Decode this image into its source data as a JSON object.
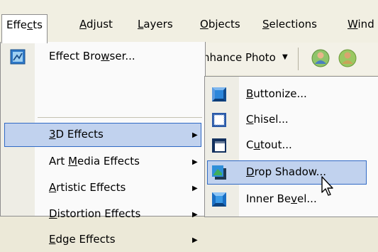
{
  "menubar": {
    "items": [
      {
        "pre": "Effe",
        "acc": "c",
        "post": "ts"
      },
      {
        "pre": "",
        "acc": "A",
        "post": "djust"
      },
      {
        "pre": "",
        "acc": "L",
        "post": "ayers"
      },
      {
        "pre": "",
        "acc": "O",
        "post": "bjects"
      },
      {
        "pre": "",
        "acc": "S",
        "post": "elections"
      },
      {
        "pre": "",
        "acc": "W",
        "post": "ind"
      }
    ]
  },
  "toolbar": {
    "enhance_label": "nhance Photo",
    "dropdown_arrow": "▼"
  },
  "effects_menu": {
    "items": [
      {
        "pre": "Effect Bro",
        "acc": "w",
        "post": "ser...",
        "arrow": ""
      },
      {
        "pre": "",
        "acc": "3",
        "post": "D Effects",
        "arrow": "▶"
      },
      {
        "pre": "Art ",
        "acc": "M",
        "post": "edia Effects",
        "arrow": "▶"
      },
      {
        "pre": "",
        "acc": "A",
        "post": "rtistic Effects",
        "arrow": "▶"
      },
      {
        "pre": "",
        "acc": "D",
        "post": "istortion Effects",
        "arrow": "▶"
      },
      {
        "pre": "",
        "acc": "E",
        "post": "dge Effects",
        "arrow": "▶"
      }
    ]
  },
  "submenu": {
    "items": [
      {
        "pre": "",
        "acc": "B",
        "post": "uttonize..."
      },
      {
        "pre": "",
        "acc": "C",
        "post": "hisel..."
      },
      {
        "pre": "C",
        "acc": "u",
        "post": "tout..."
      },
      {
        "pre": "",
        "acc": "D",
        "post": "rop Shadow..."
      },
      {
        "pre": "Inner Be",
        "acc": "v",
        "post": "el..."
      }
    ]
  },
  "colors": {
    "highlight_fill": "#c1d2ee",
    "highlight_border": "#316ac5",
    "menu_bg": "#fafafa",
    "gutter_bg": "#eeede5"
  }
}
